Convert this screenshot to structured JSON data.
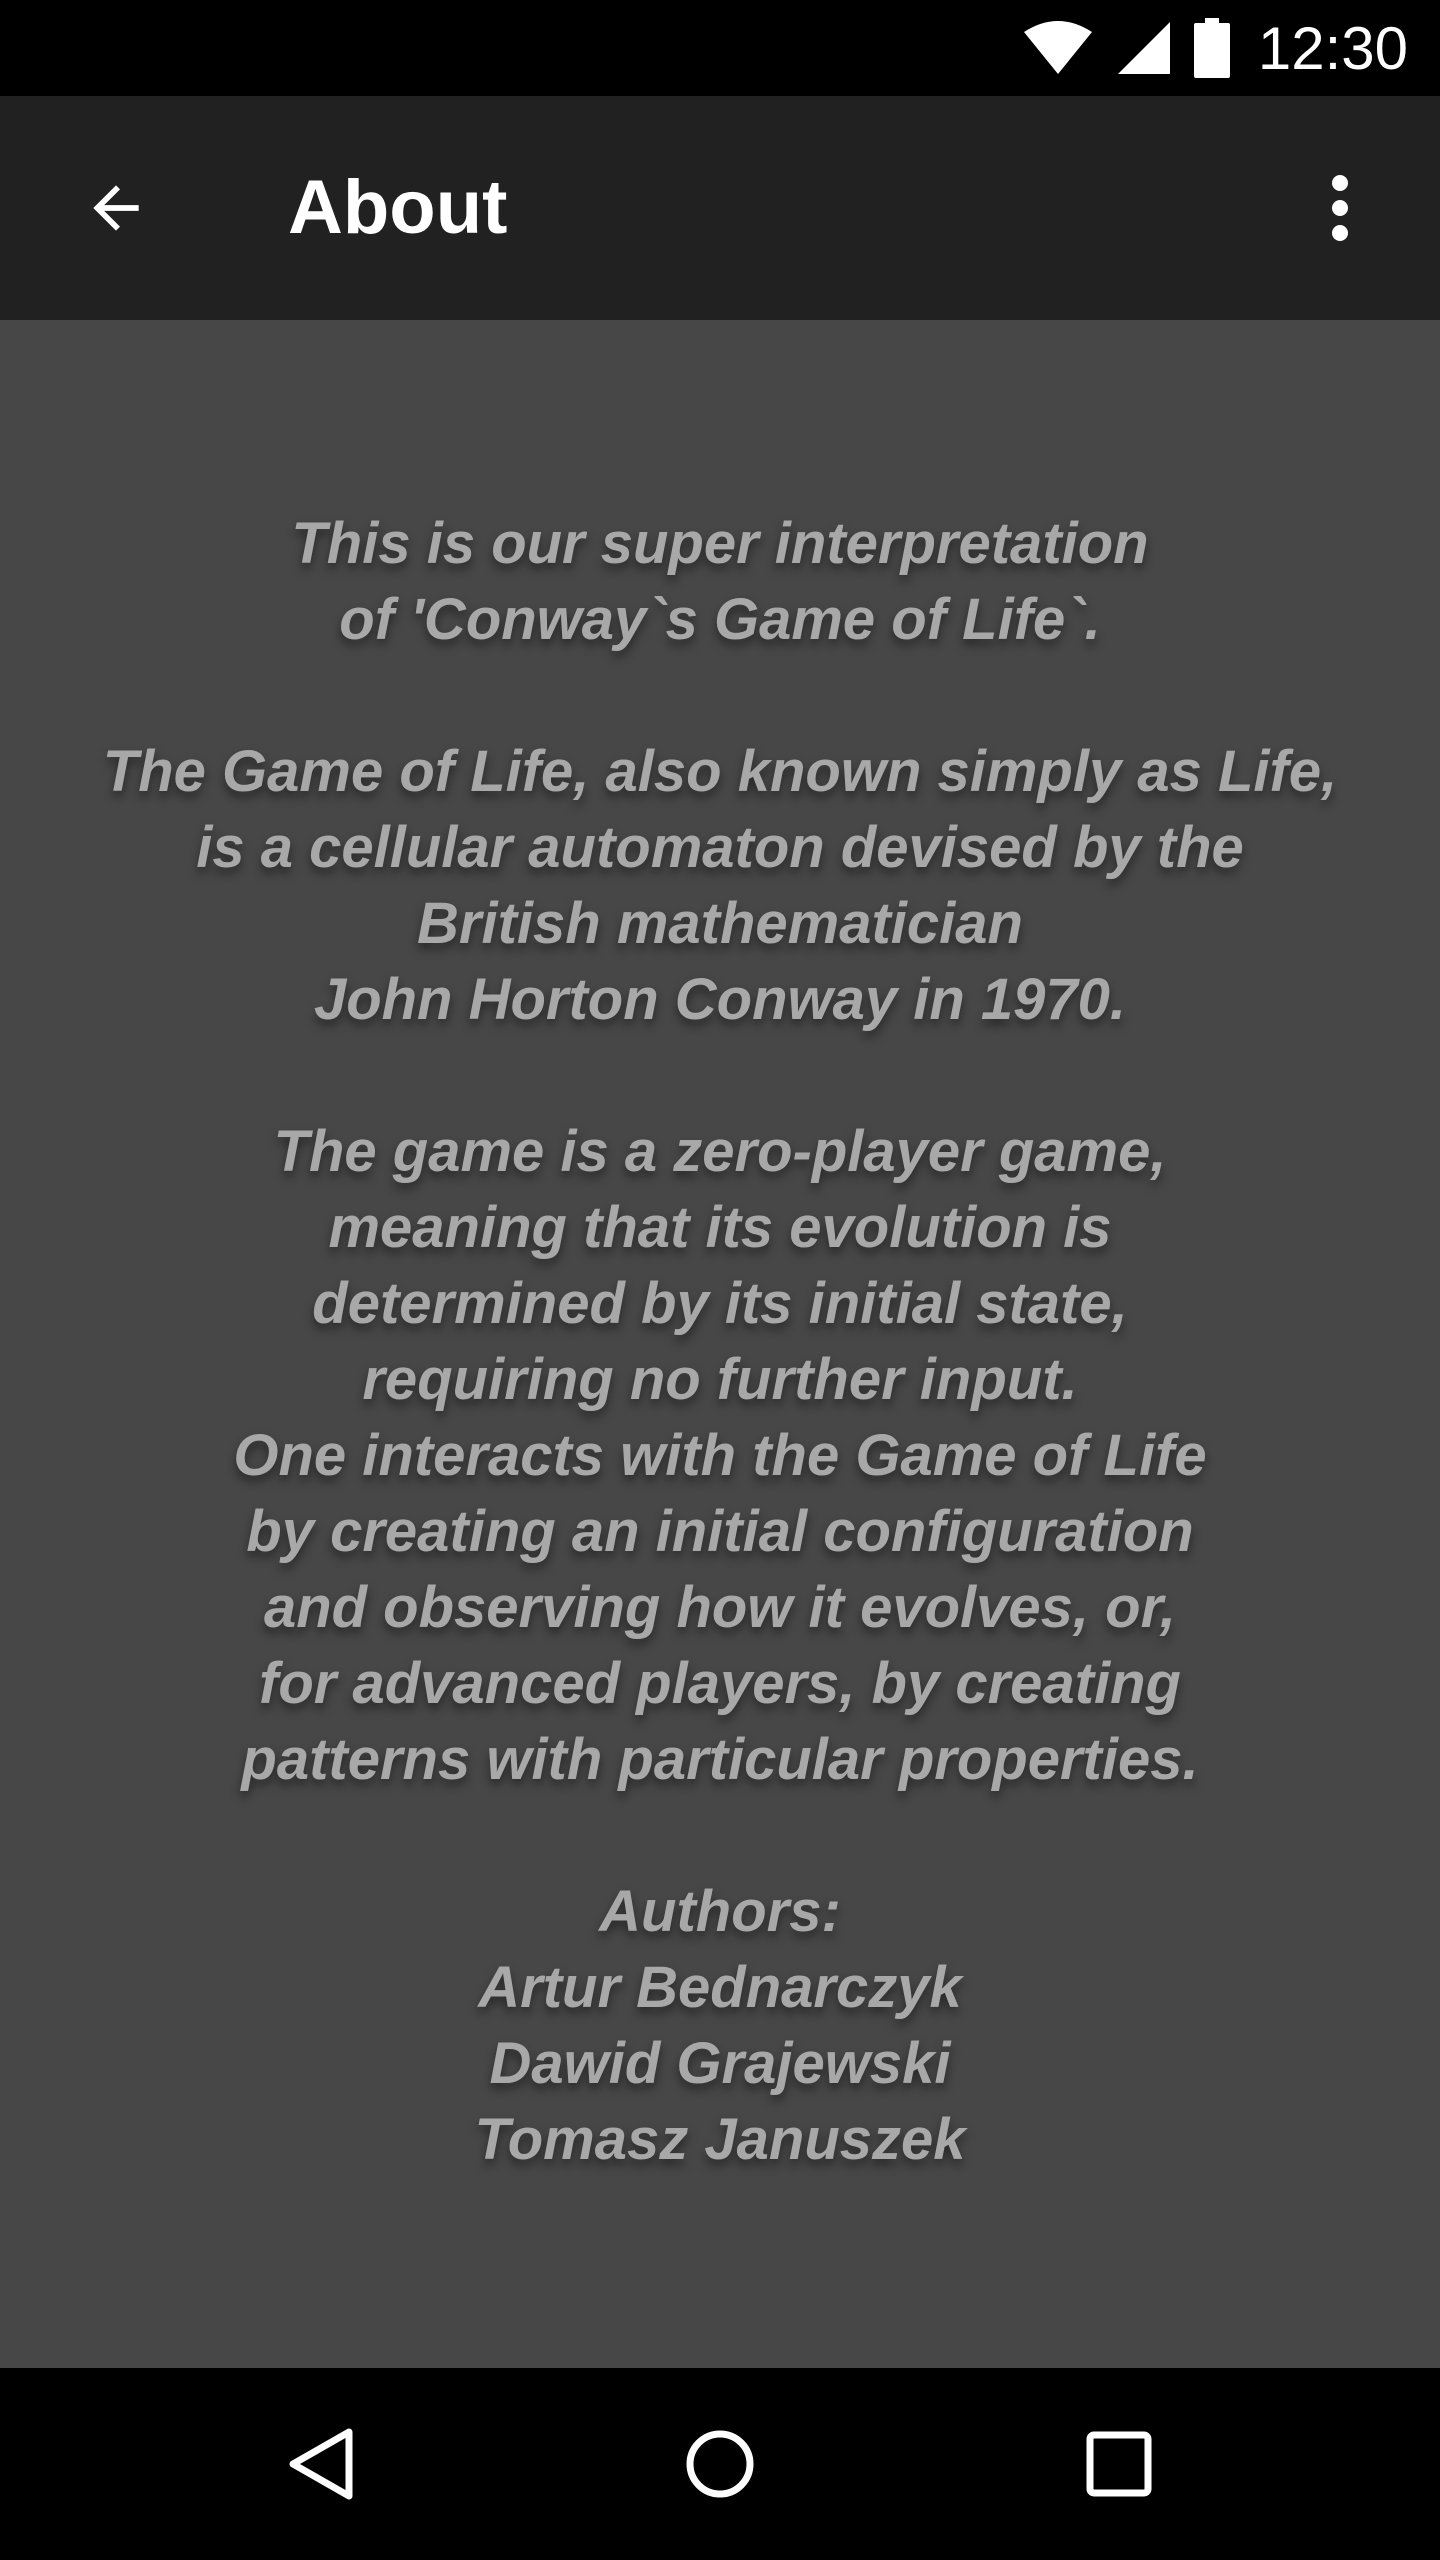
{
  "status_bar": {
    "time": "12:30",
    "icons": [
      "wifi-icon",
      "cellular-signal-icon",
      "battery-icon"
    ]
  },
  "app_bar": {
    "title": "About",
    "back_icon": "arrow-back-icon",
    "menu_icon": "more-vert-icon"
  },
  "about": {
    "lines": [
      "This is our super interpretation",
      "of 'Conway`s Game of Life`.",
      "",
      "The Game of Life, also known simply as Life,",
      "is a cellular automaton devised by the",
      "British mathematician",
      "John Horton Conway in 1970.",
      "",
      "The game is a zero-player game,",
      "meaning that its evolution is",
      "determined by its initial state,",
      "requiring no further input.",
      "One interacts with the Game of Life",
      "by creating an initial configuration",
      "and observing how it evolves, or,",
      "for advanced players, by creating",
      "patterns with particular properties.",
      "",
      "Authors:",
      "Artur Bednarczyk",
      "Dawid Grajewski",
      "Tomasz Januszek"
    ]
  },
  "nav_bar": {
    "back_icon": "nav-back-icon",
    "home_icon": "nav-home-icon",
    "recents_icon": "nav-recents-icon"
  },
  "colors": {
    "status_bar_bg": "#000000",
    "app_bar_bg": "#212121",
    "content_bg": "#474747",
    "text": "#a8a8a8",
    "nav_bar_bg": "#000000"
  }
}
